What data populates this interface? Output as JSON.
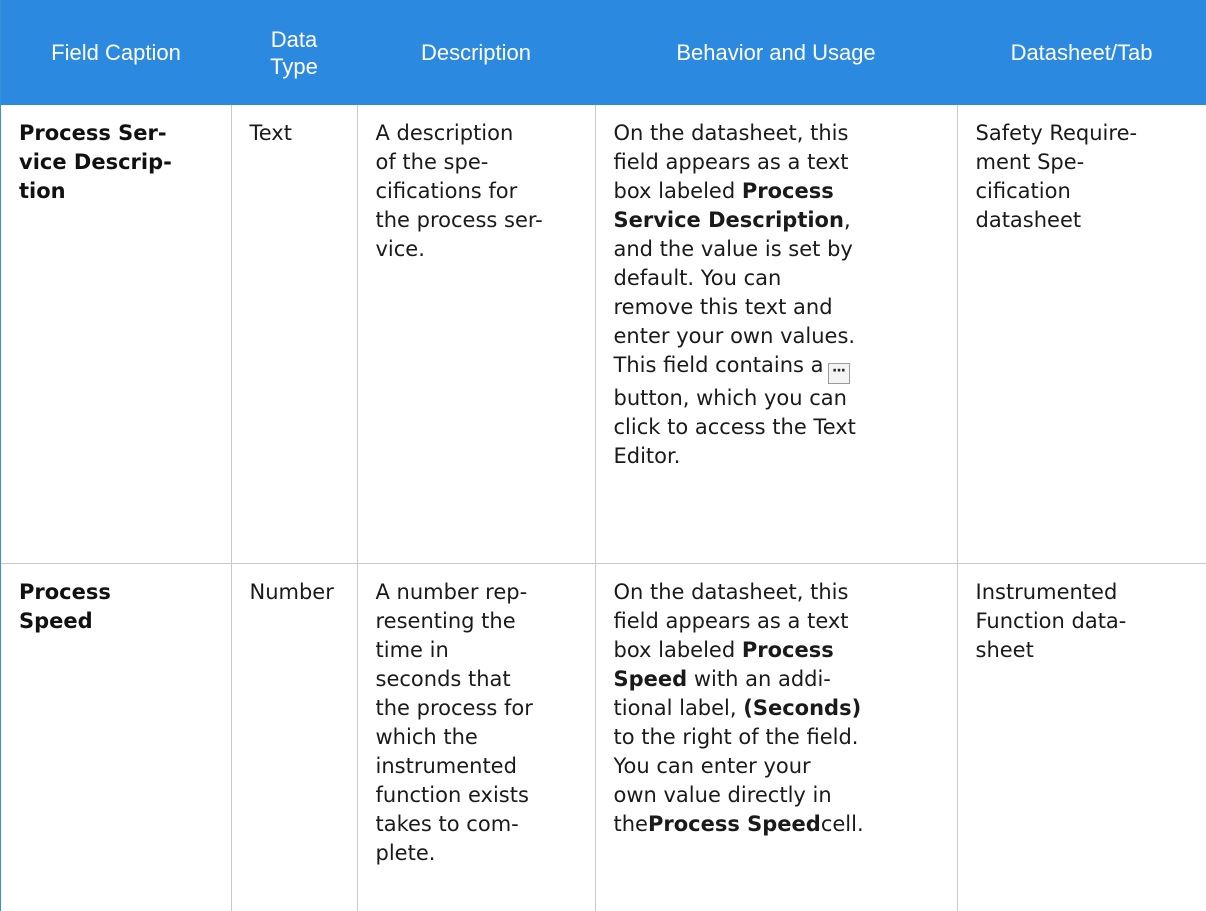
{
  "header": {
    "field_caption": "Field Caption",
    "data_type_line1": "Data",
    "data_type_line2": "Type",
    "description": "Description",
    "behavior": "Behavior and Usage",
    "datasheet_tab": "Datasheet/Tab"
  },
  "rows": [
    {
      "caption_lines": [
        "Process Ser-",
        "vice Descrip-",
        "tion"
      ],
      "data_type": "Text",
      "description_lines": [
        "A description",
        "of the spe-",
        "cifications for",
        "the process ser-",
        "vice."
      ],
      "behavior": {
        "l1": "On the datasheet, this",
        "l2": "field appears as a text",
        "l3a": "box labeled ",
        "l3b": "Process",
        "l4a": "Service Description",
        "l4b": ",",
        "l5": "and the value is set by",
        "l6": "default. You can",
        "l7": "remove this text and",
        "l8": "enter your own values.",
        "l9": "This field contains a",
        "l10": "button, which you can",
        "l11": "click to access the Text",
        "l12": "Editor.",
        "button_icon": "ellipsis-button-icon",
        "button_glyph": "···"
      },
      "datasheet_lines": [
        "Safety Require-",
        "ment Spe-",
        "cification",
        "datasheet"
      ]
    },
    {
      "caption_lines": [
        "Process",
        "Speed"
      ],
      "data_type": "Number",
      "description_lines": [
        "A number rep-",
        "resenting the",
        "time in",
        "seconds that",
        "the process for",
        "which the",
        "instrumented",
        "function exists",
        "takes to com-",
        "plete."
      ],
      "behavior": {
        "l1": "On the datasheet, this",
        "l2": "field appears as a text",
        "l3a": "box labeled ",
        "l3b": "Process",
        "l4a": "Speed",
        "l4b": " with an addi-",
        "l5a": "tional label, ",
        "l5b": "(Seconds)",
        "l6": "to the right of the field.",
        "l7": "You can enter your",
        "l8": "own value directly in",
        "l9a": "the",
        "l9b": "Process Speed",
        "l9c": "cell."
      },
      "datasheet_lines": [
        "Instrumented",
        "Function data-",
        "sheet"
      ]
    }
  ],
  "colors": {
    "header_bg": "#2c89e0",
    "header_text": "#ffffff",
    "grid_line": "#c9c9c9"
  }
}
